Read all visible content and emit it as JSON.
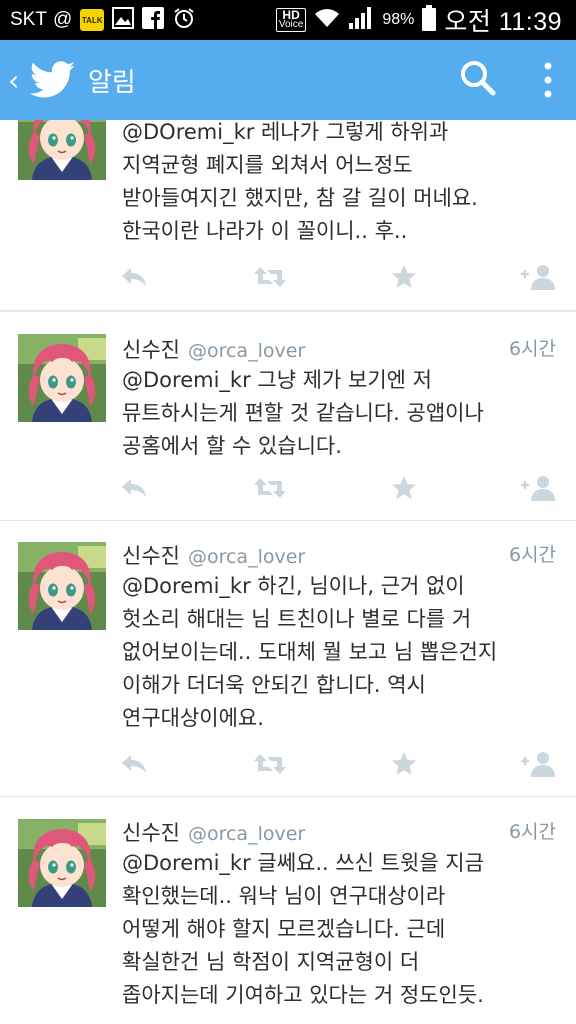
{
  "status_bar": {
    "carrier": "SKT",
    "at_symbol": "@",
    "talk_label": "TALK",
    "hd_label": "HD",
    "voice_label": "Voice",
    "battery": "98%",
    "time": "오전 11:39"
  },
  "action_bar": {
    "title": "알림",
    "color": "#55acee"
  },
  "tweets": [
    {
      "name": "",
      "handle": "",
      "time": "",
      "lines": [
        "@DOremi_kr 레나가 그렇게 하위과",
        "지역균형 폐지를 외쳐서 어느정도",
        "받아들여지긴 했지만, 참 갈 길이 머네요.",
        "한국이란 나라가 이 꼴이니.. 후.."
      ]
    },
    {
      "name": "신수진",
      "handle": "@orca_lover",
      "time": "6시간",
      "lines": [
        "@Doremi_kr 그냥 제가 보기엔 저",
        "뮤트하시는게 편할 것 같습니다. 공앱이나",
        "공홈에서 할 수 있습니다."
      ]
    },
    {
      "name": "신수진",
      "handle": "@orca_lover",
      "time": "6시간",
      "lines": [
        "@Doremi_kr 하긴, 님이나, 근거 없이",
        "헛소리 해대는 님 트친이나 별로 다를 거",
        "없어보이는데.. 도대체 뭘 보고 님 뽑은건지",
        "이해가 더더욱 안되긴 합니다. 역시",
        "연구대상이에요."
      ]
    },
    {
      "name": "신수진",
      "handle": "@orca_lover",
      "time": "6시간",
      "lines": [
        "@Doremi_kr 글쎄요.. 쓰신 트윗을 지금",
        "확인했는데.. 워낙 님이 연구대상이라",
        "어떻게 해야 할지 모르겠습니다. 근데",
        "확실한건 님 학점이 지역균형이 더",
        "좁아지는데 기여하고 있다는 거 정도인듯."
      ]
    }
  ]
}
